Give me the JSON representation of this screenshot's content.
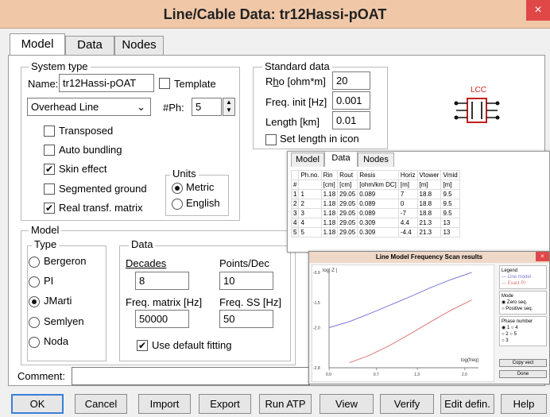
{
  "window": {
    "title": "Line/Cable Data: tr12Hassi-pOAT",
    "close": "×"
  },
  "tabs": [
    {
      "label": "Model"
    },
    {
      "label": "Data"
    },
    {
      "label": "Nodes"
    }
  ],
  "system_type": {
    "legend": "System type",
    "name_label": "Name:",
    "name_value": "tr12Hassi-pOAT",
    "template_label": "Template",
    "line_type": "Overhead Line",
    "nph_label": "#Ph:",
    "nph_value": "5",
    "transposed_label": "Transposed",
    "auto_bundling_label": "Auto bundling",
    "skin_effect_label": "Skin effect",
    "segmented_ground_label": "Segmented ground",
    "real_transf_label": "Real transf. matrix",
    "units_legend": "Units",
    "metric_label": "Metric",
    "english_label": "English"
  },
  "standard_data": {
    "legend": "Standard data",
    "rho_label_pre": "R",
    "rho_label_u": "h",
    "rho_label_post": "o [ohm*m]",
    "rho_value": "20",
    "freq_label": "Freq. init [Hz]",
    "freq_value": "0.001",
    "length_label": "Length [km]",
    "length_value": "0.01",
    "set_length_label": "Set length in icon"
  },
  "lcc_icon": {
    "label": "LCC"
  },
  "model": {
    "legend": "Model",
    "type_legend": "Type",
    "types": [
      "Bergeron",
      "PI",
      "JMarti",
      "Semlyen",
      "Noda"
    ],
    "data_legend": "Data",
    "decades_label": "Decades",
    "decades_value": "8",
    "points_label": "Points/Dec",
    "points_value": "10",
    "freq_matrix_label": "Freq. matrix [Hz]",
    "freq_matrix_value": "50000",
    "freq_ss_label": "Freq. SS [Hz]",
    "freq_ss_value": "50",
    "use_default_label": "Use default fitting"
  },
  "comment": {
    "label": "Comment:",
    "value": ""
  },
  "buttons": {
    "ok": "OK",
    "cancel": "Cancel",
    "import": "Import",
    "export": "Export",
    "run_atp": "Run ATP",
    "view": "View",
    "verify": "Verify",
    "edit_defin": "Edit defin.",
    "help": "Help"
  },
  "data_overlay": {
    "tabs": [
      "Model",
      "Data",
      "Nodes"
    ],
    "headers": [
      "",
      "Ph.no.",
      "Rin",
      "Rout",
      "Resis",
      "Horiz",
      "Vtower",
      "Vmid"
    ],
    "units": [
      "#",
      "",
      "[cm]",
      "[cm]",
      "[ohm/km DC]",
      "[m]",
      "[m]",
      "[m]"
    ],
    "rows": [
      [
        "1",
        "1",
        "1.18",
        "29.05",
        "0.089",
        "7",
        "18.8",
        "9.5"
      ],
      [
        "2",
        "2",
        "1.18",
        "29.05",
        "0.089",
        "0",
        "18.8",
        "9.5"
      ],
      [
        "3",
        "3",
        "1.18",
        "29.05",
        "0.089",
        "-7",
        "18.8",
        "9.5"
      ],
      [
        "4",
        "4",
        "1.18",
        "29.05",
        "0.309",
        "4.4",
        "21.3",
        "13"
      ],
      [
        "5",
        "5",
        "1.18",
        "29.05",
        "0.309",
        "-4.4",
        "21.3",
        "13"
      ]
    ]
  },
  "scan": {
    "title": "Line Model Frequency Scan results",
    "close": "×",
    "ylabel": "log| Z |",
    "xlabel": "log(freq)",
    "legend_title": "Legend",
    "legend_line1": "Line model",
    "legend_line2": "Exact PI",
    "mode_label": "Mode",
    "mode_zero": "Zero seq.",
    "mode_pos": "Positive seq.",
    "phase_label": "Phase number",
    "phases": [
      "1",
      "2",
      "3",
      "4",
      "5"
    ],
    "copy_btn": "Copy vect",
    "done_btn": "Done",
    "colors": {
      "line_model": "#7a78d8",
      "exact_pi": "#d87878"
    }
  },
  "chart_data": {
    "type": "line",
    "xlabel": "log(freq)",
    "ylabel": "log| Z |",
    "x_ticks": [
      "0.0",
      "0.7",
      "1.3",
      "2.0"
    ],
    "y_ticks": [
      "-0.9",
      "-1.5",
      "-2.0",
      "-2.8"
    ],
    "xlim": [
      0,
      2.2
    ],
    "ylim": [
      -2.8,
      -0.9
    ],
    "series": [
      {
        "name": "Line model",
        "x": [
          0,
          0.3,
          0.6,
          0.9,
          1.2,
          1.5,
          1.8,
          2.1
        ],
        "y": [
          -2.0,
          -1.88,
          -1.72,
          -1.55,
          -1.38,
          -1.2,
          -1.04,
          -0.9
        ]
      },
      {
        "name": "Exact PI",
        "x": [
          0.3,
          0.6,
          0.9,
          1.2,
          1.5,
          1.8,
          2.1
        ],
        "y": [
          -2.7,
          -2.55,
          -2.35,
          -2.12,
          -1.88,
          -1.65,
          -1.45
        ]
      }
    ]
  }
}
